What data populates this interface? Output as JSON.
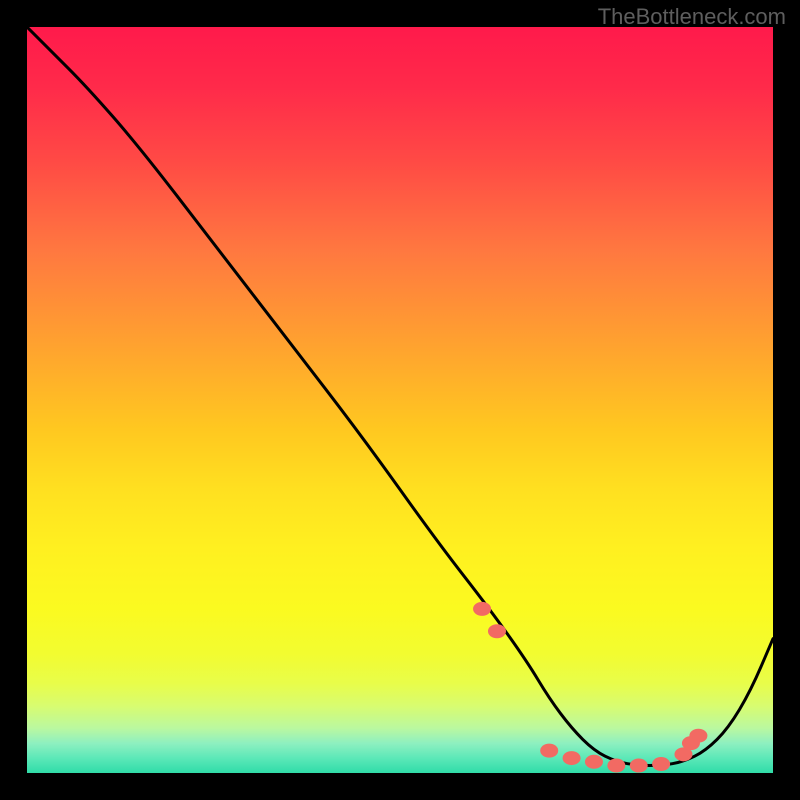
{
  "watermark": "TheBottleneck.com",
  "chart_data": {
    "type": "line",
    "title": "",
    "xlabel": "",
    "ylabel": "",
    "xlim": [
      0,
      100
    ],
    "ylim": [
      0,
      100
    ],
    "curve": {
      "x": [
        0,
        3,
        8,
        15,
        25,
        35,
        45,
        55,
        62,
        67,
        70,
        73,
        76,
        79,
        82,
        85,
        88,
        91,
        94,
        97,
        100
      ],
      "y": [
        100,
        97,
        92,
        84,
        71,
        58,
        45,
        31,
        22,
        15,
        10,
        6,
        3,
        1.5,
        1,
        1,
        1.5,
        3,
        6,
        11,
        18
      ]
    },
    "markers": {
      "x": [
        61,
        63,
        70,
        73,
        76,
        79,
        82,
        85,
        88,
        89,
        90
      ],
      "y": [
        22,
        19,
        3,
        2,
        1.5,
        1,
        1,
        1.2,
        2.5,
        4,
        5
      ]
    },
    "gradient_stops": [
      {
        "pct": 0,
        "color": "#ff1a4b"
      },
      {
        "pct": 8,
        "color": "#ff2a4a"
      },
      {
        "pct": 18,
        "color": "#ff4a45"
      },
      {
        "pct": 30,
        "color": "#ff7840"
      },
      {
        "pct": 42,
        "color": "#ffa030"
      },
      {
        "pct": 54,
        "color": "#ffc820"
      },
      {
        "pct": 62,
        "color": "#ffe020"
      },
      {
        "pct": 70,
        "color": "#fff020"
      },
      {
        "pct": 78,
        "color": "#fbfa20"
      },
      {
        "pct": 84,
        "color": "#f2fc30"
      },
      {
        "pct": 88,
        "color": "#e8fd4a"
      },
      {
        "pct": 91,
        "color": "#d8fc70"
      },
      {
        "pct": 94,
        "color": "#baf8a0"
      },
      {
        "pct": 96,
        "color": "#8ef0c0"
      },
      {
        "pct": 98,
        "color": "#5ce8b8"
      },
      {
        "pct": 100,
        "color": "#30dca8"
      }
    ],
    "marker_color": "#f26a63",
    "curve_color": "#000000"
  }
}
